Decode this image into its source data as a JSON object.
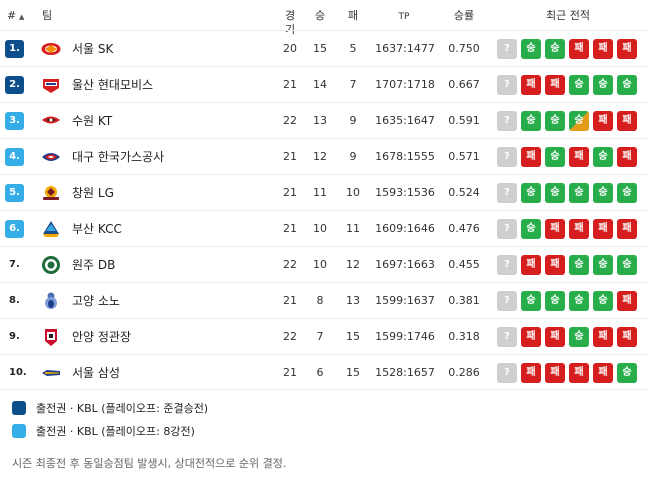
{
  "header": {
    "rank": "#",
    "sort_indicator": "▲",
    "team": "팀",
    "games": "경기",
    "wins": "승",
    "losses": "패",
    "tp": "TP",
    "pct": "승률",
    "form": "최근 전적"
  },
  "colors": {
    "playoff_direct": "#0d4f8b",
    "playoff_six": "#35aee8",
    "win": "#27ae4a",
    "loss": "#d61e1e",
    "unknown": "#cfcfcf"
  },
  "form_labels": {
    "unknown": "?",
    "win": "승",
    "loss": "패"
  },
  "standings": [
    {
      "rank": "1.",
      "zone": "dark",
      "team": "서울 SK",
      "logo": "sk-logo",
      "games": "20",
      "wins": "15",
      "losses": "5",
      "tp": "1637:1477",
      "pct": "0.750",
      "form": [
        "w",
        "w",
        "l",
        "l",
        "l"
      ]
    },
    {
      "rank": "2.",
      "zone": "dark",
      "team": "울산 현대모비스",
      "logo": "mobis-logo",
      "games": "21",
      "wins": "14",
      "losses": "7",
      "tp": "1707:1718",
      "pct": "0.667",
      "form": [
        "l",
        "l",
        "w",
        "w",
        "w"
      ]
    },
    {
      "rank": "3.",
      "zone": "light",
      "team": "수원 KT",
      "logo": "kt-logo",
      "games": "22",
      "wins": "13",
      "losses": "9",
      "tp": "1635:1647",
      "pct": "0.591",
      "form": [
        "w",
        "w",
        "d",
        "l",
        "l"
      ]
    },
    {
      "rank": "4.",
      "zone": "light",
      "team": "대구 한국가스공사",
      "logo": "kogas-logo",
      "games": "21",
      "wins": "12",
      "losses": "9",
      "tp": "1678:1555",
      "pct": "0.571",
      "form": [
        "l",
        "w",
        "l",
        "w",
        "l"
      ]
    },
    {
      "rank": "5.",
      "zone": "light",
      "team": "창원 LG",
      "logo": "lg-logo",
      "games": "21",
      "wins": "11",
      "losses": "10",
      "tp": "1593:1536",
      "pct": "0.524",
      "form": [
        "w",
        "w",
        "w",
        "w",
        "w"
      ]
    },
    {
      "rank": "6.",
      "zone": "light",
      "team": "부산 KCC",
      "logo": "kcc-logo",
      "games": "21",
      "wins": "10",
      "losses": "11",
      "tp": "1609:1646",
      "pct": "0.476",
      "form": [
        "w",
        "l",
        "l",
        "l",
        "l"
      ]
    },
    {
      "rank": "7.",
      "zone": "none",
      "team": "원주 DB",
      "logo": "db-logo",
      "games": "22",
      "wins": "10",
      "losses": "12",
      "tp": "1697:1663",
      "pct": "0.455",
      "form": [
        "l",
        "l",
        "w",
        "w",
        "w"
      ]
    },
    {
      "rank": "8.",
      "zone": "none",
      "team": "고양 소노",
      "logo": "sono-logo",
      "games": "21",
      "wins": "8",
      "losses": "13",
      "tp": "1599:1637",
      "pct": "0.381",
      "form": [
        "w",
        "w",
        "w",
        "w",
        "l"
      ]
    },
    {
      "rank": "9.",
      "zone": "none",
      "team": "안양 정관장",
      "logo": "kgc-logo",
      "games": "22",
      "wins": "7",
      "losses": "15",
      "tp": "1599:1746",
      "pct": "0.318",
      "form": [
        "l",
        "l",
        "w",
        "l",
        "l"
      ]
    },
    {
      "rank": "10.",
      "zone": "none",
      "team": "서울 삼성",
      "logo": "samsung-logo",
      "games": "21",
      "wins": "6",
      "losses": "15",
      "tp": "1528:1657",
      "pct": "0.286",
      "form": [
        "l",
        "l",
        "l",
        "l",
        "w"
      ]
    }
  ],
  "legend": [
    {
      "zone": "dark",
      "text": "출전권 · KBL (플레이오프: 준결승전)"
    },
    {
      "zone": "light",
      "text": "출전권 · KBL (플레이오프: 8강전)"
    }
  ],
  "footnote": "시즌 최종전 후 동일승점팀 발생시, 상대전적으로 순위 결정."
}
